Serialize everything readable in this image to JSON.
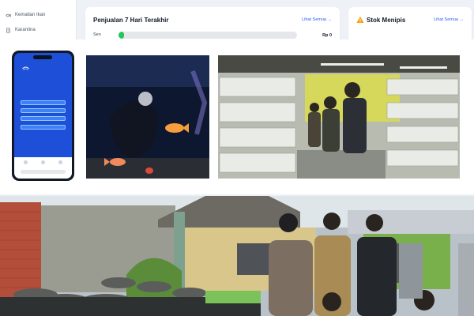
{
  "sidebar": {
    "items": [
      {
        "label": "Kematian Ikan",
        "icon": "fish-icon"
      },
      {
        "label": "Karantina",
        "icon": "document-icon"
      }
    ]
  },
  "sales_card": {
    "title": "Penjualan 7 Hari Terakhir",
    "link": "Lihat Semua →",
    "day_label": "Sen",
    "value_label": "Rp 0",
    "bar_fraction": 0.03,
    "bar_color": "#22c55e"
  },
  "stock_card": {
    "title": "Stok Menipis",
    "link": "Lihat Semua →",
    "icon": "warning-icon",
    "icon_color": "#f59e0b"
  },
  "collage": {
    "phone_icon": "app-logo-icon",
    "photos": [
      "phone-mockup",
      "aquarium-photo",
      "fish-store-photo",
      "outdoor-team-photo"
    ]
  },
  "colors": {
    "accent": "#2563eb",
    "app_blue": "#1e4fd8"
  }
}
